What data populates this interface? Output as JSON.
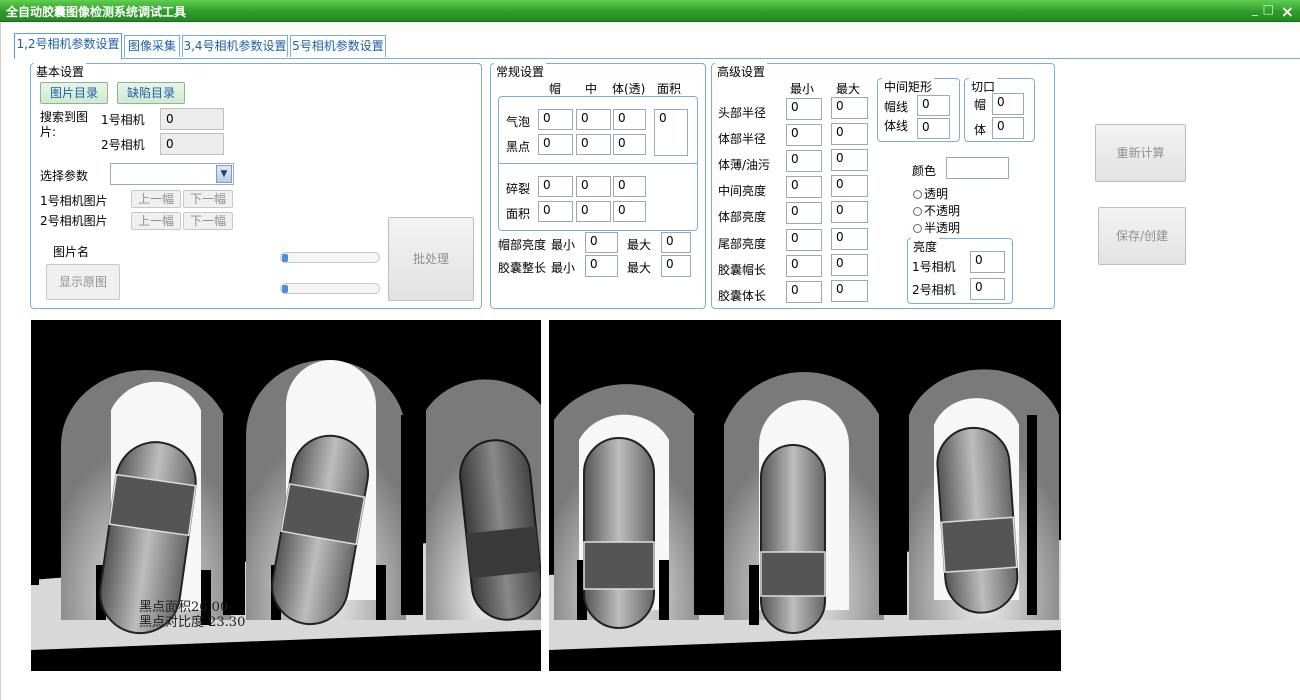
{
  "window": {
    "title": "全自动胶囊图像检测系统调试工具",
    "minimize": "_",
    "maximize": "□",
    "close": "×"
  },
  "tabs": [
    {
      "label": "1,2号相机参数设置"
    },
    {
      "label": "图像采集"
    },
    {
      "label": "3,4号相机参数设置"
    },
    {
      "label": "5号相机参数设置"
    }
  ],
  "basic": {
    "legend": "基本设置",
    "image_dir_btn": "图片目录",
    "defect_dir_btn": "缺陷目录",
    "found_label": "搜索到图片:",
    "cam1_label": "1号相机",
    "cam1_value": "0",
    "cam2_label": "2号相机",
    "cam2_value": "0",
    "select_param_label": "选择参数",
    "select_param_value": "",
    "cam1_img_label": "1号相机图片",
    "cam2_img_label": "2号相机图片",
    "prev_btn": "上一幅",
    "next_btn": "下一幅",
    "img_name_label": "图片名",
    "show_original_btn": "显示原图",
    "batch_btn": "批处理"
  },
  "general": {
    "legend": "常规设置",
    "headers": [
      "帽",
      "中",
      "体(透)",
      "面积"
    ],
    "rows_a": [
      {
        "label": "气泡",
        "values": [
          "0",
          "0",
          "0"
        ]
      },
      {
        "label": "黑点",
        "values": [
          "0",
          "0",
          "0"
        ]
      }
    ],
    "area_value": "0",
    "rows_b": [
      {
        "label": "碎裂",
        "values": [
          "0",
          "0",
          "0"
        ]
      },
      {
        "label": "面积",
        "values": [
          "0",
          "0",
          "0"
        ]
      }
    ],
    "cap_brightness": {
      "label": "帽部亮度",
      "min_label": "最小",
      "min": "0",
      "max_label": "最大",
      "max": "0"
    },
    "full_length": {
      "label": "胶囊整长",
      "min_label": "最小",
      "min": "0",
      "max_label": "最大",
      "max": "0"
    }
  },
  "advanced": {
    "legend": "高级设置",
    "min_header": "最小",
    "max_header": "最大",
    "rows": [
      {
        "label": "头部半径",
        "min": "0",
        "max": "0"
      },
      {
        "label": "体部半径",
        "min": "0",
        "max": "0"
      },
      {
        "label": "体薄/油污",
        "min": "0",
        "max": "0"
      },
      {
        "label": "中间亮度",
        "min": "0",
        "max": "0"
      },
      {
        "label": "体部亮度",
        "min": "0",
        "max": "0"
      },
      {
        "label": "尾部亮度",
        "min": "0",
        "max": "0"
      },
      {
        "label": "胶囊帽长",
        "min": "0",
        "max": "0"
      },
      {
        "label": "胶囊体长",
        "min": "0",
        "max": "0"
      }
    ],
    "mid_rect": {
      "legend": "中间矩形",
      "cap_line_label": "帽线",
      "cap_line": "0",
      "body_line_label": "体线",
      "body_line": "0"
    },
    "cut": {
      "legend": "切口",
      "cap_label": "帽",
      "cap": "0",
      "body_label": "体",
      "body": "0"
    },
    "color_label": "颜色",
    "color_value": "",
    "radios": [
      {
        "label": "透明"
      },
      {
        "label": "不透明"
      },
      {
        "label": "半透明"
      }
    ],
    "brightness": {
      "legend": "亮度",
      "cam1_label": "1号相机",
      "cam1": "0",
      "cam2_label": "2号相机",
      "cam2": "0"
    }
  },
  "actions": {
    "recalc_btn": "重新计算",
    "save_btn": "保存/创建"
  },
  "image_panels": {
    "left_overlay_line1": "黑点面积26.00",
    "left_overlay_line2": "黑点对比度 23.30"
  },
  "colors": {
    "titlebar": "#2f9d2a",
    "tab_border": "#7ab0d6",
    "tab_text": "#1b5fa8"
  }
}
